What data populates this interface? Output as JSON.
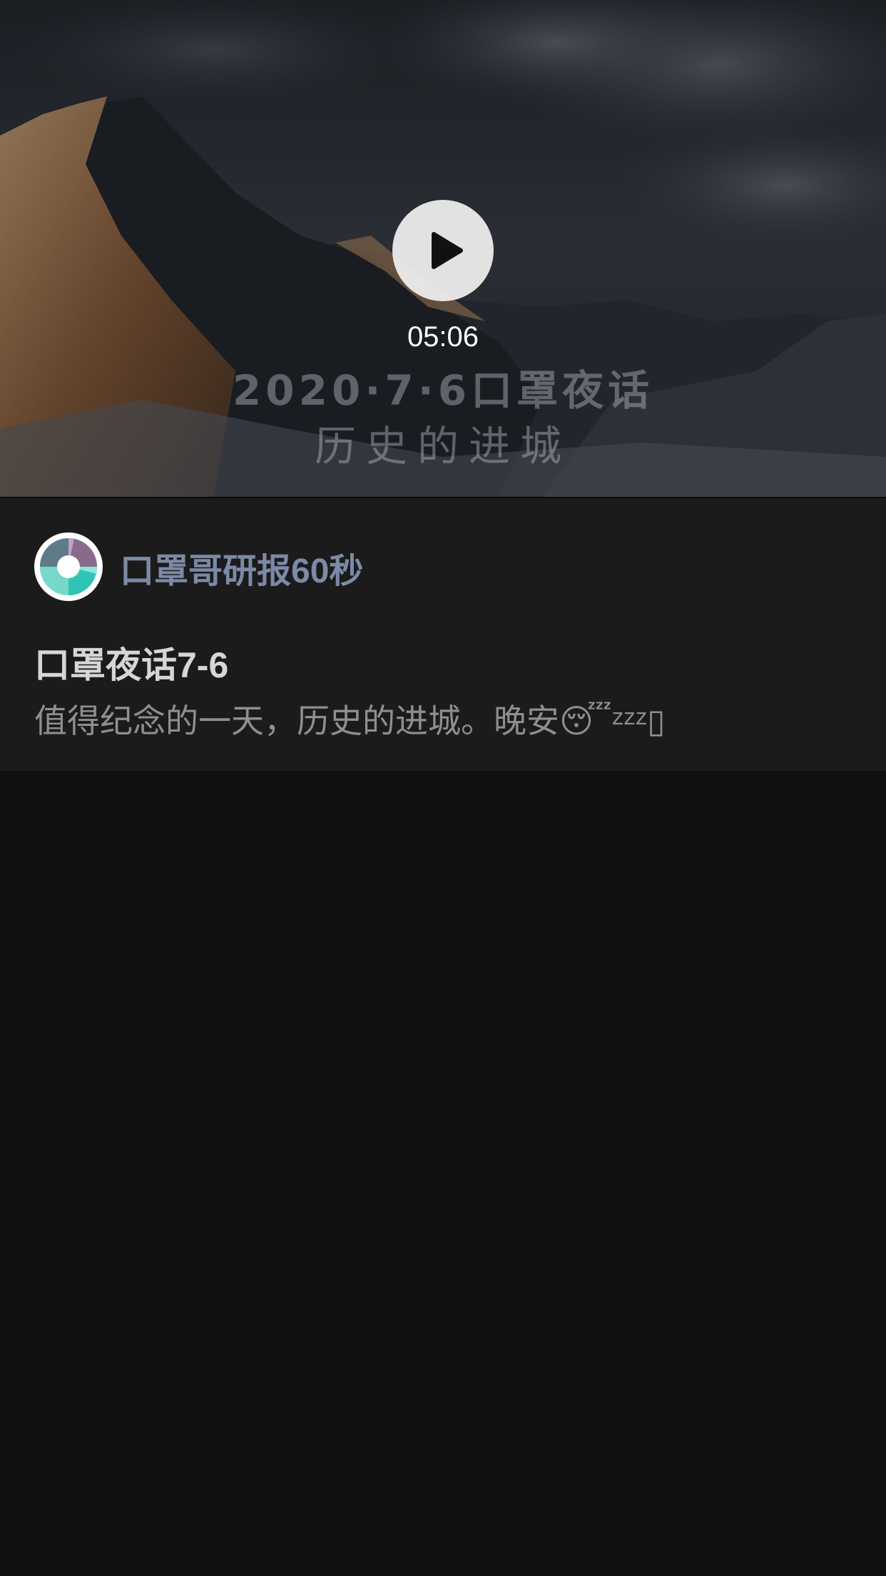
{
  "video": {
    "overlay_line1": "2020·7·6口罩夜话",
    "overlay_line2": "历史的进城",
    "duration": "05:06",
    "play_icon": "play-icon"
  },
  "post": {
    "author_name": "口罩哥研报60秒",
    "avatar_icon": "disc-avatar",
    "title": "口罩夜话7-6",
    "description": "值得纪念的一天，历史的进城。晚安😴ᶻᶻᶻ▯"
  },
  "colors": {
    "background": "#111111",
    "card": "#1b1b1b",
    "author": "#7b8aa6",
    "title": "#d6d6d6",
    "description": "#8f8f8f"
  }
}
